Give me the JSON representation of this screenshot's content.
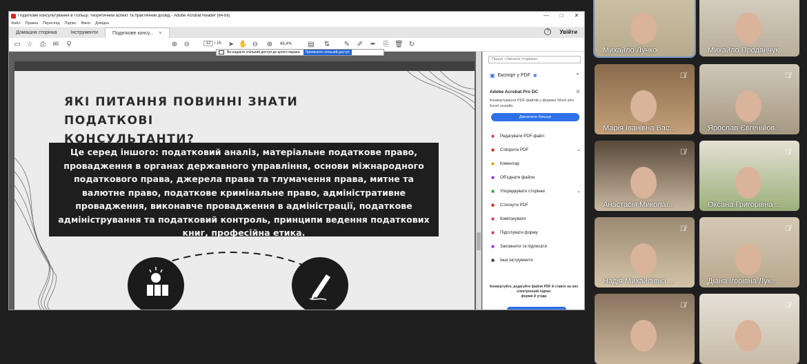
{
  "window": {
    "title": "Податкове консультування в Польщі: теоретичний аспект та практичний досвід - Adobe Acrobat Reader (64-bit)",
    "minimize": "—",
    "maximize": "□",
    "close": "✕"
  },
  "menu": [
    "Файл",
    "Правка",
    "Перегляд",
    "Підпис",
    "Вікно",
    "Довідка"
  ],
  "tabs": [
    {
      "label": "Домашня сторінка"
    },
    {
      "label": "Інструменти"
    },
    {
      "label": "Податкове консу...",
      "close": "×"
    }
  ],
  "header_right": {
    "help": "?",
    "signin": "Увійти"
  },
  "toolbar": {
    "page_current": "12",
    "page_total": "/ 16",
    "zoom": "66,4%"
  },
  "share_notice": {
    "text": "Ви надаєте спільний доступ до цілого екрана.",
    "button": "Припинити спільний доступ"
  },
  "slide": {
    "title": "ЯКІ ПИТАННЯ ПОВИННІ ЗНАТИ ПОДАТКОВІ\nКОНСУЛЬТАНТИ?",
    "body": "Це серед іншого: податковий аналіз, матеріальне податкове право, провадження в органах державного управління, основи міжнародного податкового права, джерела права та тлумачення права, митне та валютне право, податкове кримінальне право, адміністративне провадження, виконавче провадження в адміністрації, податкове адміністрування та податковий контроль, принципи ведення податкових книг, професійна етика."
  },
  "side_panel": {
    "search_placeholder": "Пошук «Змінити сторінки»",
    "export_label": "Експорт у PDF",
    "pro_title": "Adobe Acrobat Pro DC",
    "pro_desc": "Конвертування PDF-файлів у формат Word або Excel онлайн",
    "learn_more": "Дізнатися більше",
    "tools": [
      {
        "label": "Редагувати PDF-файл",
        "icon": "edit-pdf-icon",
        "color": "#d8347e",
        "chev": ""
      },
      {
        "label": "Створити PDF",
        "icon": "create-pdf-icon",
        "color": "#d9261c",
        "chev": "⌄"
      },
      {
        "label": "Коментар",
        "icon": "comment-icon",
        "color": "#e5a100",
        "chev": ""
      },
      {
        "label": "Об'єднати файли",
        "icon": "combine-icon",
        "color": "#7a3ee0",
        "chev": ""
      },
      {
        "label": "Упорядкувати сторінки",
        "icon": "organize-icon",
        "color": "#2da04c",
        "chev": "⌄"
      },
      {
        "label": "Стиснути PDF",
        "icon": "compress-icon",
        "color": "#d9261c",
        "chev": ""
      },
      {
        "label": "Компонувати",
        "icon": "compose-icon",
        "color": "#d8347e",
        "chev": ""
      },
      {
        "label": "Підготувати форму",
        "icon": "prepare-form-icon",
        "color": "#d8347e",
        "chev": ""
      },
      {
        "label": "Заповнити та підписати",
        "icon": "fill-sign-icon",
        "color": "#8c3fd1",
        "chev": ""
      },
      {
        "label": "Інші інструменти",
        "icon": "more-tools-icon",
        "color": "#333333",
        "chev": ""
      }
    ],
    "footer": "Конвертуйте, редагуйте файли PDF й ставте на них електронний підпис\nформи й угоди"
  },
  "participants": [
    {
      "name": "Михайло Лучко",
      "muted": false,
      "active": true
    },
    {
      "name": "Михайло Проданчук",
      "muted": true,
      "active": false
    },
    {
      "name": "Марія Іванівна Вас...",
      "muted": true,
      "active": false
    },
    {
      "name": "Ярослав Євгенійов...",
      "muted": true,
      "active": false
    },
    {
      "name": "Анастасія Миколаї...",
      "muted": true,
      "active": false
    },
    {
      "name": "Оксана Григорівна ...",
      "muted": true,
      "active": false
    },
    {
      "name": "Надія Михайлівна ...",
      "muted": true,
      "active": false
    },
    {
      "name": "Діана Ігорівна Лук...",
      "muted": true,
      "active": false
    },
    {
      "name": "",
      "muted": true,
      "active": false
    },
    {
      "name": "",
      "muted": true,
      "active": false
    }
  ]
}
